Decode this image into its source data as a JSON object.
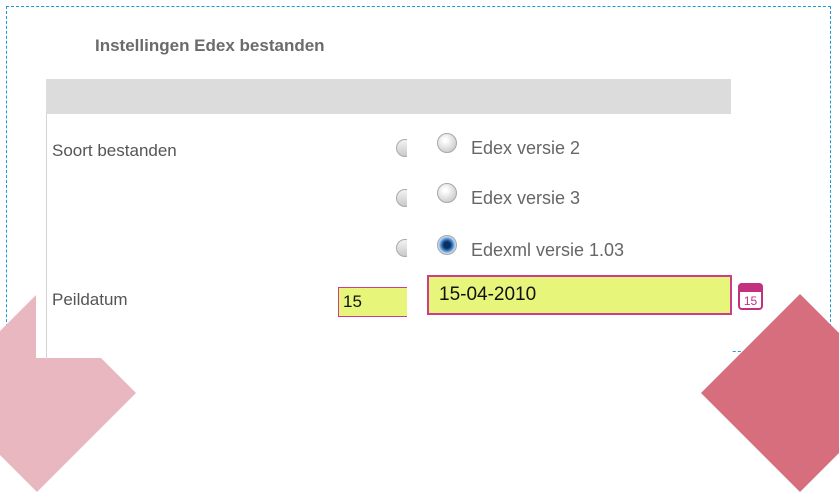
{
  "panel": {
    "title": "Instellingen Edex bestanden"
  },
  "form": {
    "soort_label": "Soort bestanden",
    "peildatum_label": "Peildatum",
    "options": [
      {
        "label": "Edex versie 2",
        "checked": false
      },
      {
        "label": "Edex versie 3",
        "checked": false
      },
      {
        "label": "Edexml versie 1.03",
        "checked": true
      }
    ],
    "peildatum_value": "15-04-2010",
    "peildatum_partial": "15",
    "calendar_day": "15"
  },
  "colors": {
    "accent_pink": "#cc3d8a",
    "date_field_bg": "#e7f57a",
    "frame_blue": "#1a9ad6"
  },
  "icons": {
    "calendar": "calendar-icon"
  }
}
